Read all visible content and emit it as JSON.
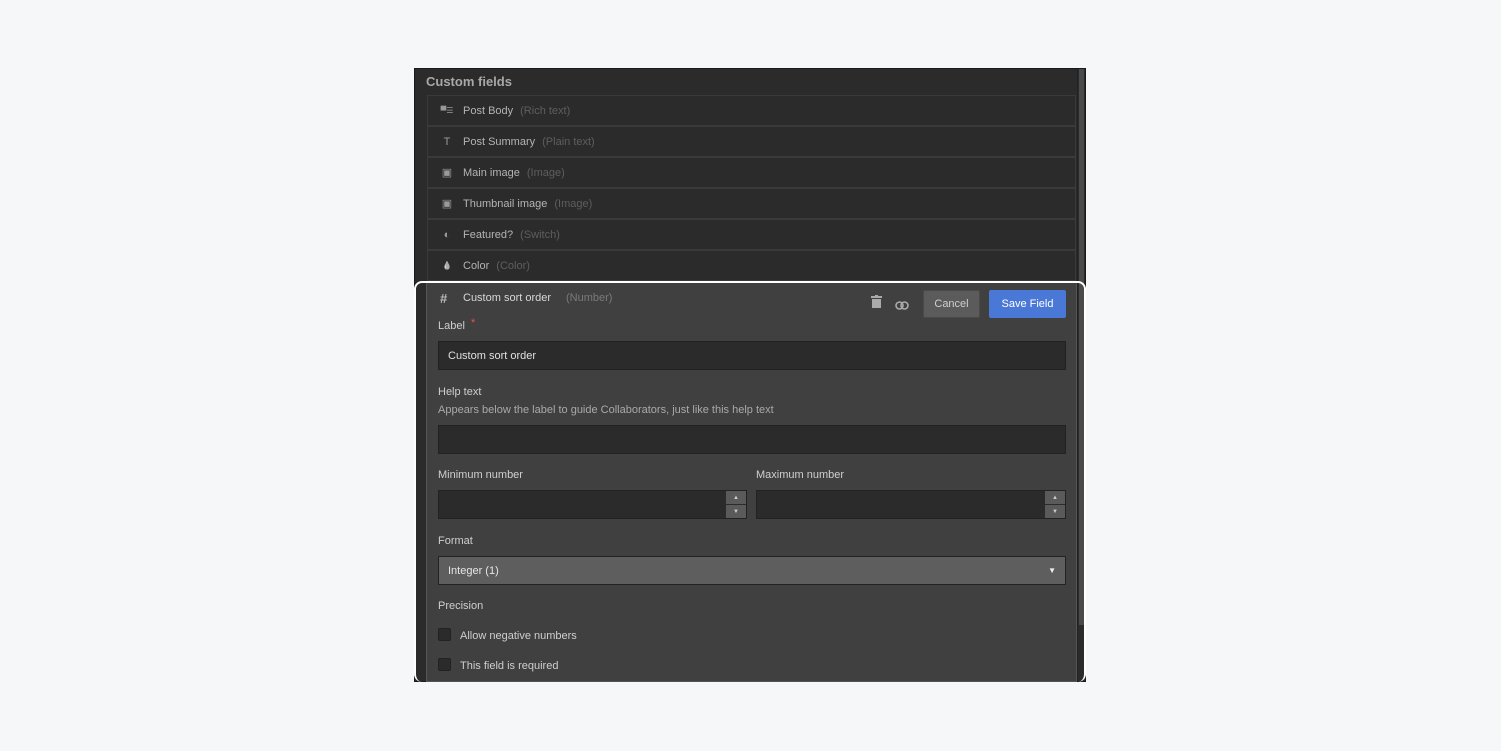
{
  "title": "Custom fields",
  "fields": [
    {
      "icon": "rich-text-icon",
      "glyph": "▀☰",
      "name": "Post Body",
      "type": "(Rich text)"
    },
    {
      "icon": "plain-text-icon",
      "glyph": "T",
      "name": "Post Summary",
      "type": "(Plain text)"
    },
    {
      "icon": "image-icon",
      "glyph": "▣",
      "name": "Main image",
      "type": "(Image)"
    },
    {
      "icon": "image-icon",
      "glyph": "▣",
      "name": "Thumbnail image",
      "type": "(Image)"
    },
    {
      "icon": "switch-icon",
      "glyph": "◐",
      "name": "Featured?",
      "type": "(Switch)"
    },
    {
      "icon": "color-drop-icon",
      "glyph": "💧",
      "name": "Color",
      "type": "(Color)"
    }
  ],
  "editor": {
    "name": "Custom sort order",
    "type": "(Number)",
    "cancel": "Cancel",
    "save": "Save Field",
    "label_label": "Label",
    "required_mark": "*",
    "label_value": "Custom sort order",
    "help_label": "Help text",
    "help_hint": "Appears below the label to guide Collaborators, just like this help text",
    "help_value": "",
    "min_label": "Minimum number",
    "max_label": "Maximum number",
    "format_label": "Format",
    "format_value": "Integer (1)",
    "precision_label": "Precision",
    "allow_negative": "Allow negative numbers",
    "allow_negative_checked": false,
    "required": "This field is required",
    "required_checked": false,
    "accent": "#4a78d6"
  }
}
